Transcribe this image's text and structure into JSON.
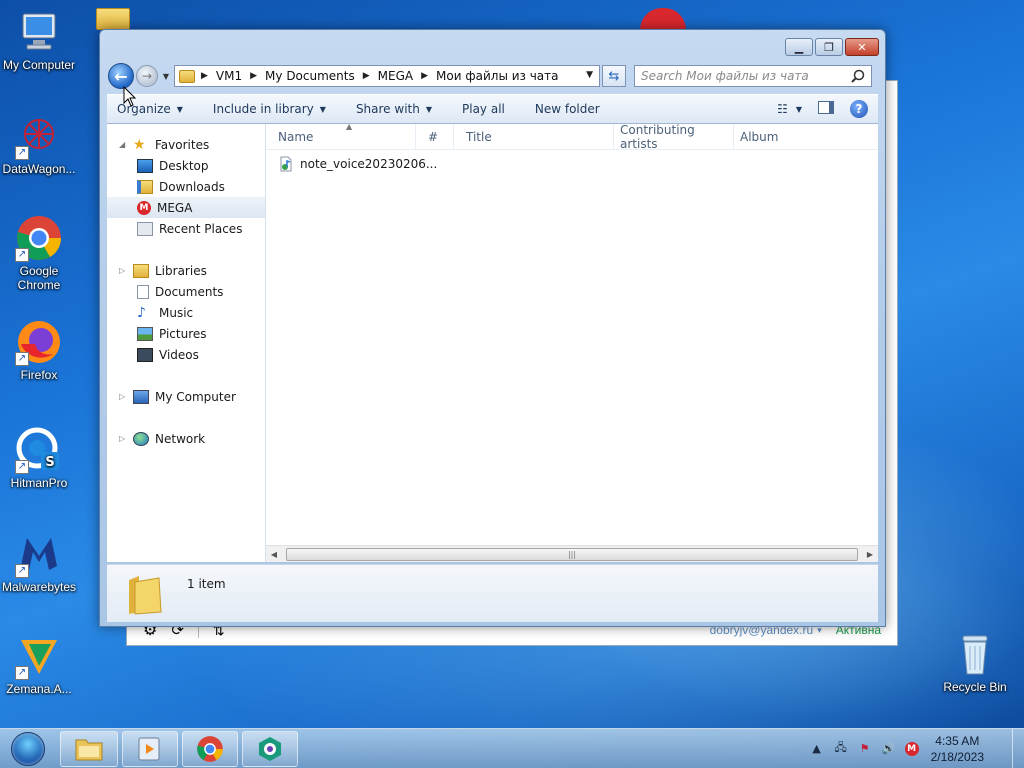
{
  "desktop": {
    "icons": [
      {
        "label": "My Computer"
      },
      {
        "label": "DataWagon..."
      },
      {
        "label": "Google Chrome"
      },
      {
        "label": "Firefox"
      },
      {
        "label": "HitmanPro"
      },
      {
        "label": "Malwarebytes"
      },
      {
        "label": "Zemana.A..."
      },
      {
        "label": "Recycle Bin"
      }
    ]
  },
  "background_window": {
    "email": "dobryjv@yandex.ru",
    "status": "Активна"
  },
  "explorer": {
    "breadcrumb": [
      "VM1",
      "My Documents",
      "MEGA",
      "Мои файлы из чата"
    ],
    "search_placeholder": "Search Мои файлы из чата",
    "toolbar": {
      "organize": "Organize",
      "include_in_library": "Include in library",
      "share_with": "Share with",
      "play_all": "Play all",
      "new_folder": "New folder"
    },
    "nav": {
      "favorites": "Favorites",
      "desktop": "Desktop",
      "downloads": "Downloads",
      "mega": "MEGA",
      "recent_places": "Recent Places",
      "libraries": "Libraries",
      "documents": "Documents",
      "music": "Music",
      "pictures": "Pictures",
      "videos": "Videos",
      "my_computer": "My Computer",
      "network": "Network"
    },
    "columns": {
      "name": "Name",
      "number": "#",
      "title": "Title",
      "contributing_artists": "Contributing artists",
      "album": "Album"
    },
    "files": [
      {
        "name": "note_voice20230206..."
      }
    ],
    "details": {
      "item_count": "1 item"
    }
  },
  "taskbar": {
    "time": "4:35 AM",
    "date": "2/18/2023"
  },
  "colors": {
    "accent": "#1f66c8",
    "mega_red": "#d9272e",
    "status_green": "#1a9a4a"
  }
}
